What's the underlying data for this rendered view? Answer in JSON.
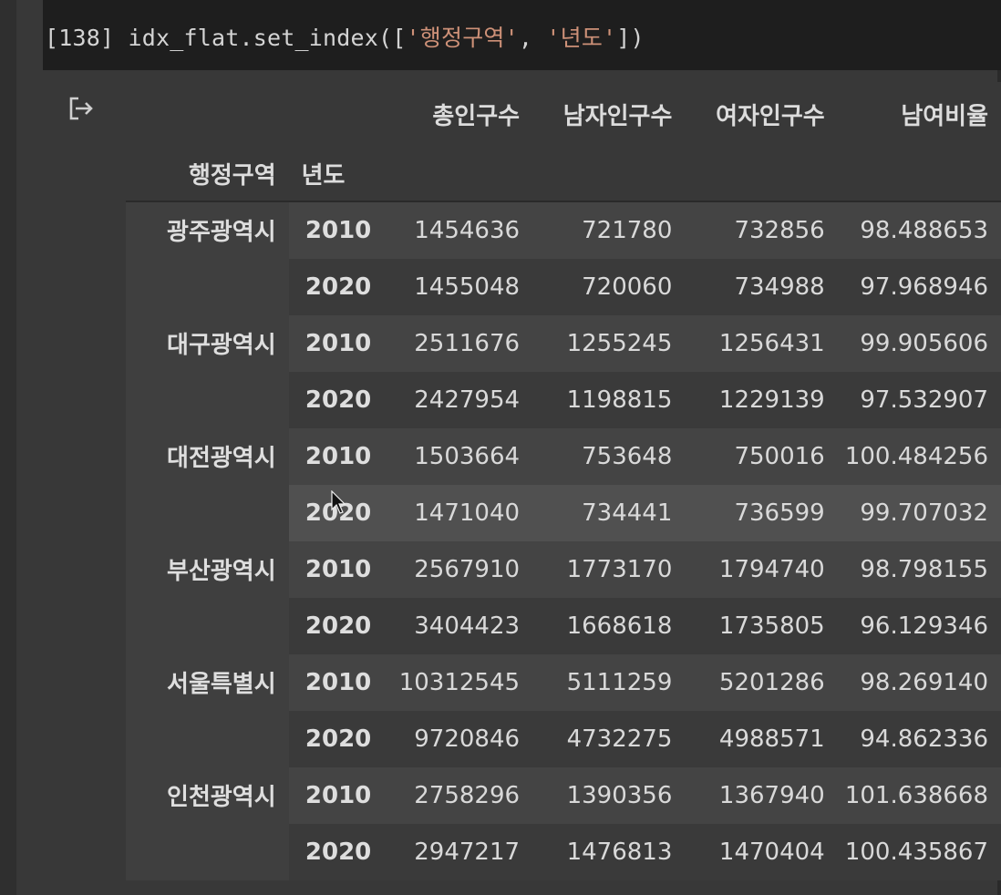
{
  "code_cell": {
    "prompt": "[138]",
    "code_prefix": " idx_flat.set_index([",
    "str1": "'행정구역'",
    "sep": ", ",
    "str2": "'년도'",
    "code_suffix": "])"
  },
  "output": {
    "icon": "output-redirect-icon",
    "columns": [
      "총인구수",
      "남자인구수",
      "여자인구수",
      "남여비율"
    ],
    "index_names": [
      "행정구역",
      "년도"
    ],
    "groups": [
      {
        "region": "광주광역시",
        "rows": [
          {
            "year": "2010",
            "values": [
              "1454636",
              "721780",
              "732856",
              "98.488653"
            ]
          },
          {
            "year": "2020",
            "values": [
              "1455048",
              "720060",
              "734988",
              "97.968946"
            ]
          }
        ]
      },
      {
        "region": "대구광역시",
        "rows": [
          {
            "year": "2010",
            "values": [
              "2511676",
              "1255245",
              "1256431",
              "99.905606"
            ]
          },
          {
            "year": "2020",
            "values": [
              "2427954",
              "1198815",
              "1229139",
              "97.532907"
            ]
          }
        ]
      },
      {
        "region": "대전광역시",
        "rows": [
          {
            "year": "2010",
            "values": [
              "1503664",
              "753648",
              "750016",
              "100.484256"
            ]
          },
          {
            "year": "2020",
            "values": [
              "1471040",
              "734441",
              "736599",
              "99.707032"
            ]
          }
        ]
      },
      {
        "region": "부산광역시",
        "rows": [
          {
            "year": "2010",
            "values": [
              "2567910",
              "1773170",
              "1794740",
              "98.798155"
            ]
          },
          {
            "year": "2020",
            "values": [
              "3404423",
              "1668618",
              "1735805",
              "96.129346"
            ]
          }
        ]
      },
      {
        "region": "서울특별시",
        "rows": [
          {
            "year": "2010",
            "values": [
              "10312545",
              "5111259",
              "5201286",
              "98.269140"
            ]
          },
          {
            "year": "2020",
            "values": [
              "9720846",
              "4732275",
              "4988571",
              "94.862336"
            ]
          }
        ]
      },
      {
        "region": "인천광역시",
        "rows": [
          {
            "year": "2010",
            "values": [
              "2758296",
              "1390356",
              "1367940",
              "101.638668"
            ]
          },
          {
            "year": "2020",
            "values": [
              "2947217",
              "1476813",
              "1470404",
              "100.435867"
            ]
          }
        ]
      }
    ]
  },
  "colors": {
    "background": "#383838",
    "code_background": "#1e1e1e",
    "string": "#ce9178",
    "text": "#d9d9d9"
  }
}
